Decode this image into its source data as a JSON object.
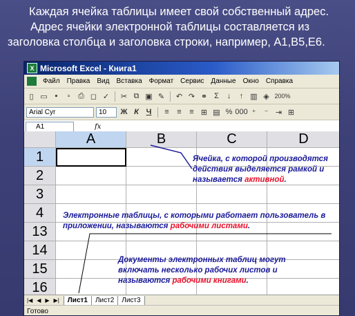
{
  "heading": {
    "line1": "Каждая ячейка таблицы имеет свой собственный адрес.",
    "line2": "Адрес ячейки электронной таблицы составляется из",
    "line3": "заголовка столбца и заголовка строки, например, А1,В5,Е6."
  },
  "window": {
    "title": "Microsoft Excel - Книга1",
    "menu": [
      "Файл",
      "Правка",
      "Вид",
      "Вставка",
      "Формат",
      "Сервис",
      "Данные",
      "Окно",
      "Справка"
    ],
    "zoom": "200%",
    "font_name": "Arial Cyr",
    "font_size": "10",
    "name_box": "A1",
    "fx_label": "fx"
  },
  "columns": [
    "A",
    "B",
    "C",
    "D"
  ],
  "rows": [
    "1",
    "2",
    "3",
    "4",
    "13",
    "14",
    "15",
    "16"
  ],
  "annotations": {
    "active_cell": {
      "text": "Ячейка, с которой производятся действия выделяется рамкой и называется",
      "highlight": "активной",
      "tail": "."
    },
    "worksheets": {
      "text": "Электронные таблицы, с которыми работает пользователь в приложении, называются",
      "highlight": "рабочими листами",
      "tail": "."
    },
    "workbooks": {
      "text": "Документы электронных таблиц могут включать несколько рабочих листов и называются",
      "highlight": "рабочими книгами",
      "tail": "."
    }
  },
  "sheet_tabs": [
    "Лист1",
    "Лист2",
    "Лист3"
  ],
  "status": "Готово",
  "colors": {
    "annotation": "#1a1a9a",
    "highlight": "#e8102a",
    "background": "#3d4178"
  }
}
